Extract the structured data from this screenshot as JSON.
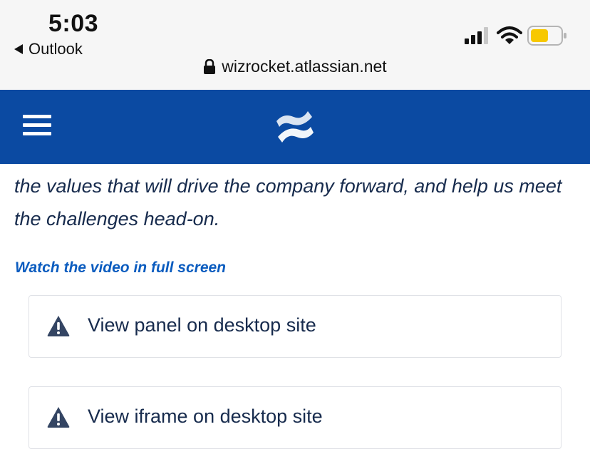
{
  "status_bar": {
    "time": "5:03",
    "back_label": "Outlook",
    "url": "wizrocket.atlassian.net",
    "battery_color": "#f7c800"
  },
  "header": {
    "background_color": "#0b4aa2",
    "menu_icon": "hamburger-icon",
    "logo_icon": "confluence-logo-icon"
  },
  "content": {
    "intro_text": "the values that will drive the company forward, and help us meet the challenges head-on.",
    "fullscreen_link": "Watch the video in full screen",
    "panels": [
      {
        "icon": "warning-icon",
        "label": "View panel on desktop site"
      },
      {
        "icon": "warning-icon",
        "label": "View iframe on desktop site"
      }
    ]
  }
}
